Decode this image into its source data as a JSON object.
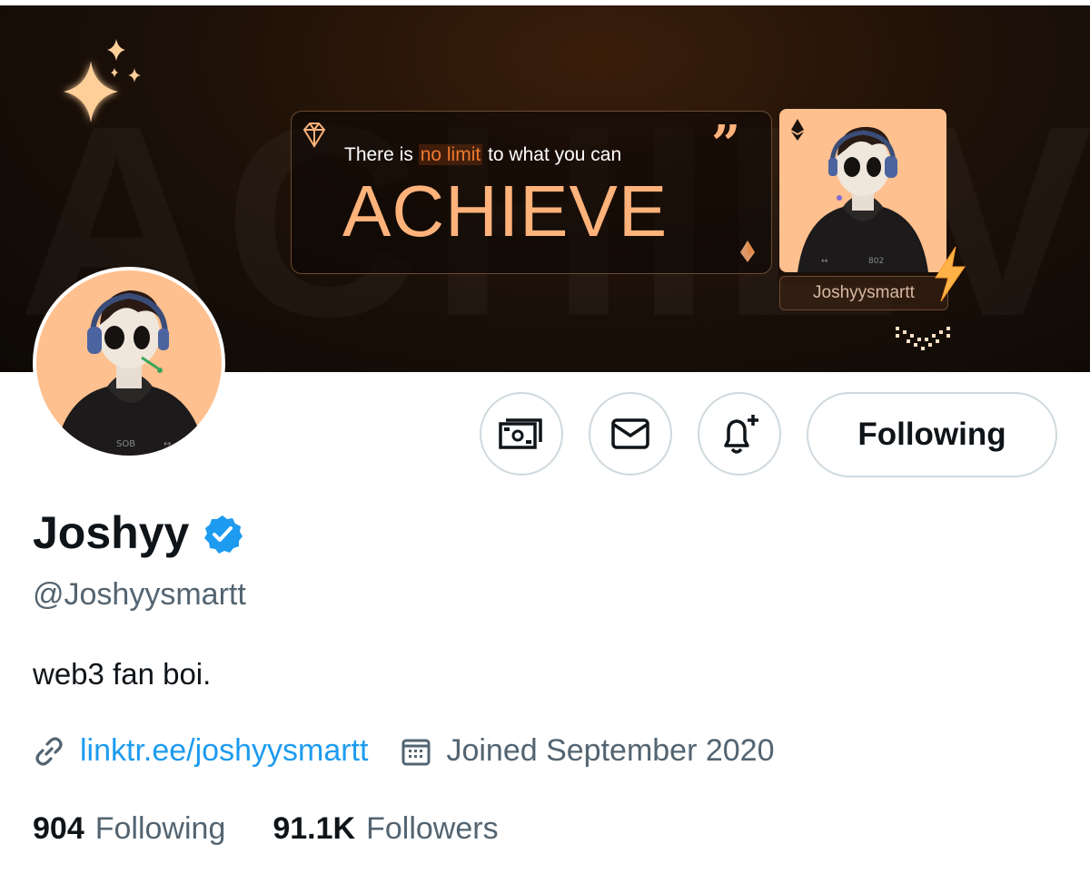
{
  "banner": {
    "quote_prefix": "There is",
    "quote_highlight": "no limit",
    "quote_suffix": "to what you can",
    "headline": "ACHIEVE",
    "card_name": "Joshyysmartt",
    "accent": "#ffb27a"
  },
  "actions": {
    "follow_label": "Following",
    "icons": [
      "tips-money-icon",
      "message-envelope-icon",
      "notification-bell-plus-icon"
    ]
  },
  "profile": {
    "display_name": "Joshyy",
    "verified": true,
    "handle": "@Joshyysmartt",
    "bio": "web3 fan boi.",
    "link": "linktr.ee/joshyysmartt",
    "joined": "Joined September 2020"
  },
  "stats": {
    "following_count": "904",
    "following_label": "Following",
    "followers_count": "91.1K",
    "followers_label": "Followers"
  },
  "colors": {
    "link": "#1d9bf0",
    "secondary_text": "#536471",
    "verified_badge": "#1d9bf0"
  }
}
